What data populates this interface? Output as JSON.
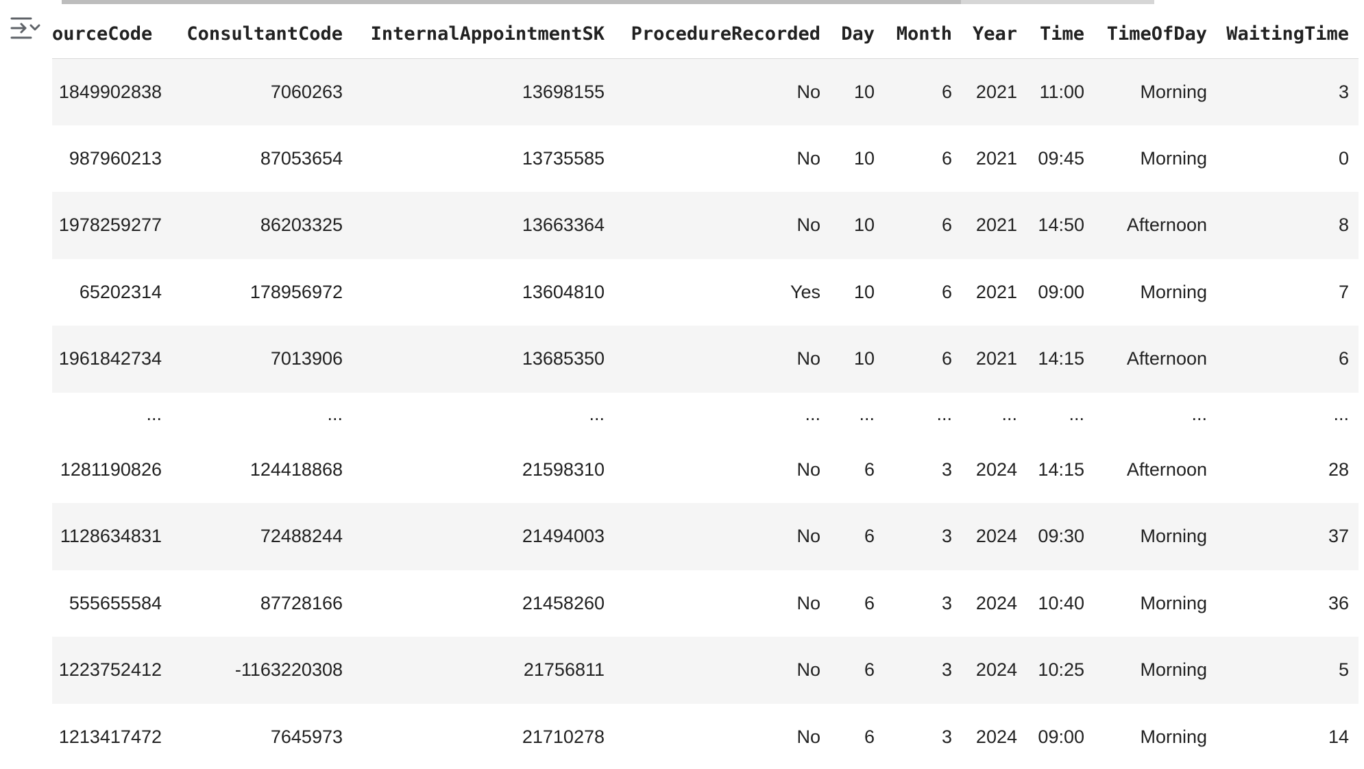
{
  "toolbar": {
    "collapse_icon": "collapse-output-icon"
  },
  "table": {
    "columns": [
      "ourceCode",
      "ConsultantCode",
      "InternalAppointmentSK",
      "ProcedureRecorded",
      "Day",
      "Month",
      "Year",
      "Time",
      "TimeOfDay",
      "WaitingTime"
    ],
    "rows": [
      [
        "1849902838",
        "7060263",
        "13698155",
        "No",
        "10",
        "6",
        "2021",
        "11:00",
        "Morning",
        "3"
      ],
      [
        "987960213",
        "87053654",
        "13735585",
        "No",
        "10",
        "6",
        "2021",
        "09:45",
        "Morning",
        "0"
      ],
      [
        "1978259277",
        "86203325",
        "13663364",
        "No",
        "10",
        "6",
        "2021",
        "14:50",
        "Afternoon",
        "8"
      ],
      [
        "65202314",
        "178956972",
        "13604810",
        "Yes",
        "10",
        "6",
        "2021",
        "09:00",
        "Morning",
        "7"
      ],
      [
        "1961842734",
        "7013906",
        "13685350",
        "No",
        "10",
        "6",
        "2021",
        "14:15",
        "Afternoon",
        "6"
      ],
      [
        "...",
        "...",
        "...",
        "...",
        "...",
        "...",
        "...",
        "...",
        "...",
        "..."
      ],
      [
        "1281190826",
        "124418868",
        "21598310",
        "No",
        "6",
        "3",
        "2024",
        "14:15",
        "Afternoon",
        "28"
      ],
      [
        "1128634831",
        "72488244",
        "21494003",
        "No",
        "6",
        "3",
        "2024",
        "09:30",
        "Morning",
        "37"
      ],
      [
        "555655584",
        "87728166",
        "21458260",
        "No",
        "6",
        "3",
        "2024",
        "10:40",
        "Morning",
        "36"
      ],
      [
        "1223752412",
        "-1163220308",
        "21756811",
        "No",
        "6",
        "3",
        "2024",
        "10:25",
        "Morning",
        "5"
      ],
      [
        "1213417472",
        "7645973",
        "21710278",
        "No",
        "6",
        "3",
        "2024",
        "09:00",
        "Morning",
        "14"
      ]
    ]
  },
  "colors": {
    "row_stripe": "#f5f5f5",
    "row_plain": "#ffffff",
    "text": "#212121",
    "divider": "#d9d9d9",
    "icon": "#5f6368"
  }
}
